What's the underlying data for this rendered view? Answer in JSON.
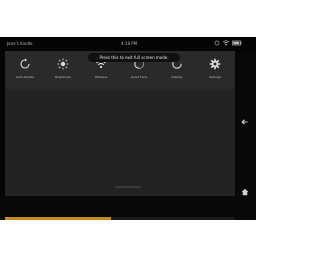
{
  "status_bar": {
    "owner": "Jane's Kindle",
    "time": "4:18 PM",
    "icons": [
      "sync-icon",
      "wifi-icon",
      "battery-icon"
    ]
  },
  "toast": "Press this to exit full screen mode.",
  "quick_settings": [
    {
      "label": "Auto-Rotate",
      "icon": "rotate-icon"
    },
    {
      "label": "Brightness",
      "icon": "brightness-icon"
    },
    {
      "label": "Wireless",
      "icon": "wifi-icon"
    },
    {
      "label": "Quiet Time",
      "icon": "quiet-time-icon"
    },
    {
      "label": "Display",
      "icon": "display-icon"
    },
    {
      "label": "Settings",
      "icon": "gear-icon"
    }
  ],
  "nav": {
    "back_icon": "back-icon",
    "home_icon": "home-icon"
  },
  "progress": 0.46,
  "colors": {
    "screen": "#050505",
    "panel": "#2a2a2a",
    "content": "#232323",
    "accent": "#c48a1e"
  }
}
